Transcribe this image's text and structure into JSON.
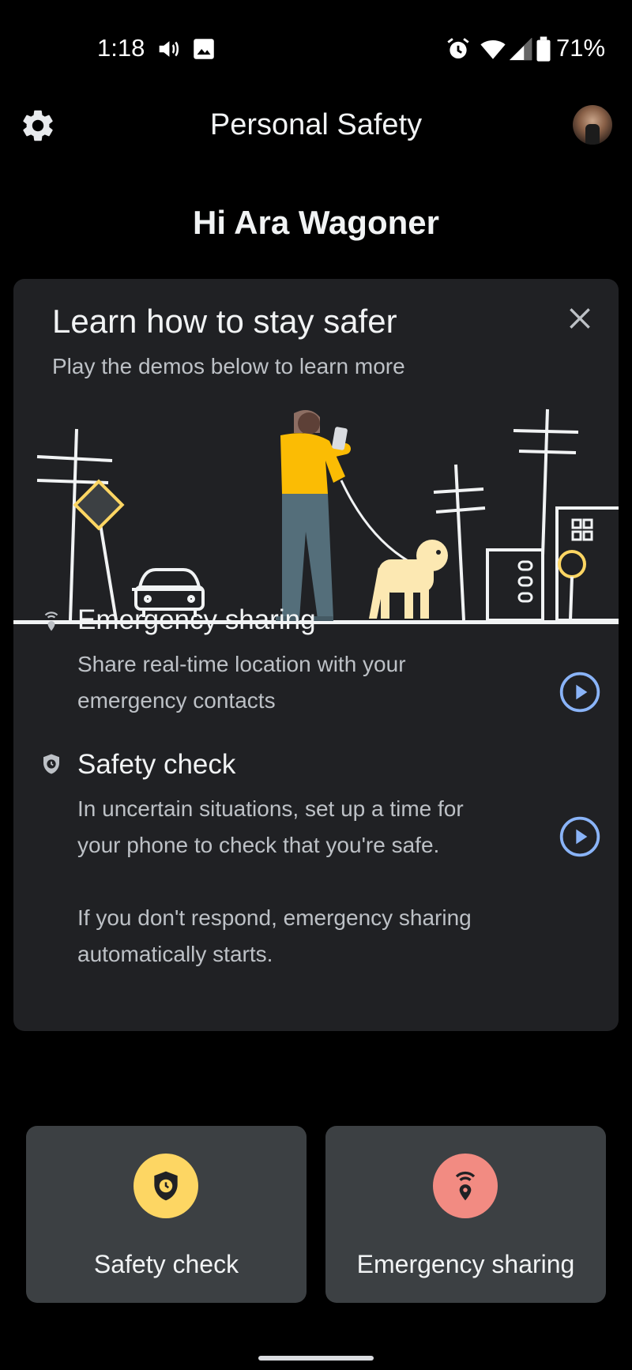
{
  "status_bar": {
    "time": "1:18",
    "battery": "71%",
    "icons": [
      "volume-icon",
      "image-icon",
      "alarm-icon",
      "wifi-icon",
      "signal-icon",
      "battery-icon"
    ]
  },
  "header": {
    "title": "Personal Safety",
    "settings_icon": "gear-icon",
    "avatar": "profile-avatar"
  },
  "greeting": "Hi Ara Wagoner",
  "learn_card": {
    "title": "Learn how to stay safer",
    "subtitle": "Play the demos below to learn more",
    "features": [
      {
        "title": "Emergency sharing",
        "description": "Share real-time location with your emergency contacts",
        "icon": "location-broadcast-icon"
      },
      {
        "title": "Safety check",
        "description": "In uncertain situations, set up a time for your phone to check that you're safe.",
        "note": "If you don't respond, emergency sharing automatically starts.",
        "icon": "shield-clock-icon"
      }
    ]
  },
  "actions": [
    {
      "label": "Safety check",
      "icon": "shield-clock-icon",
      "color": "#fdd663"
    },
    {
      "label": "Emergency sharing",
      "icon": "location-broadcast-icon",
      "color": "#f28b82"
    }
  ],
  "colors": {
    "accent_blue": "#8ab4f8",
    "card_bg": "#202124",
    "button_bg": "#3c4043"
  }
}
